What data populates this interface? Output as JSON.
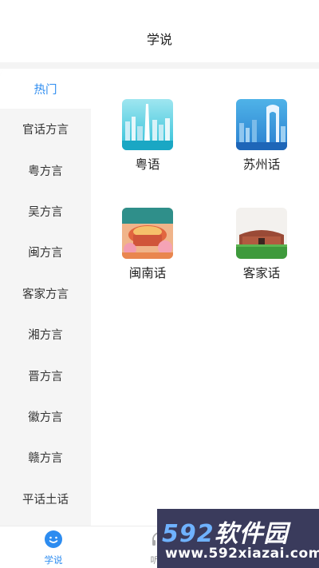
{
  "header": {
    "title": "学说"
  },
  "sidebar": {
    "items": [
      {
        "label": "热门",
        "active": true
      },
      {
        "label": "官话方言"
      },
      {
        "label": "粤方言"
      },
      {
        "label": "吴方言"
      },
      {
        "label": "闽方言"
      },
      {
        "label": "客家方言"
      },
      {
        "label": "湘方言"
      },
      {
        "label": "晋方言"
      },
      {
        "label": "徽方言"
      },
      {
        "label": "赣方言"
      },
      {
        "label": "平话土话"
      }
    ]
  },
  "dialects": [
    {
      "label": "粤语",
      "icon": "guangzhou-skyline-thumbnail"
    },
    {
      "label": "苏州话",
      "icon": "suzhou-gate-thumbnail"
    },
    {
      "label": "闽南话",
      "icon": "tulou-illustration-thumbnail"
    },
    {
      "label": "客家话",
      "icon": "hakka-tulou-thumbnail"
    }
  ],
  "tabbar": {
    "tabs": [
      {
        "label": "学说",
        "icon": "smile-icon",
        "active": true
      },
      {
        "label": "听话",
        "icon": "headphones-icon",
        "active": false
      }
    ]
  },
  "watermark": {
    "brand_num": "592",
    "brand_cn": "软件园",
    "url": "www.592xiazai.com"
  },
  "colors": {
    "accent": "#2d8cf0",
    "sidebar_bg": "#f5f5f5",
    "watermark_bg": "#3a3b5c"
  }
}
